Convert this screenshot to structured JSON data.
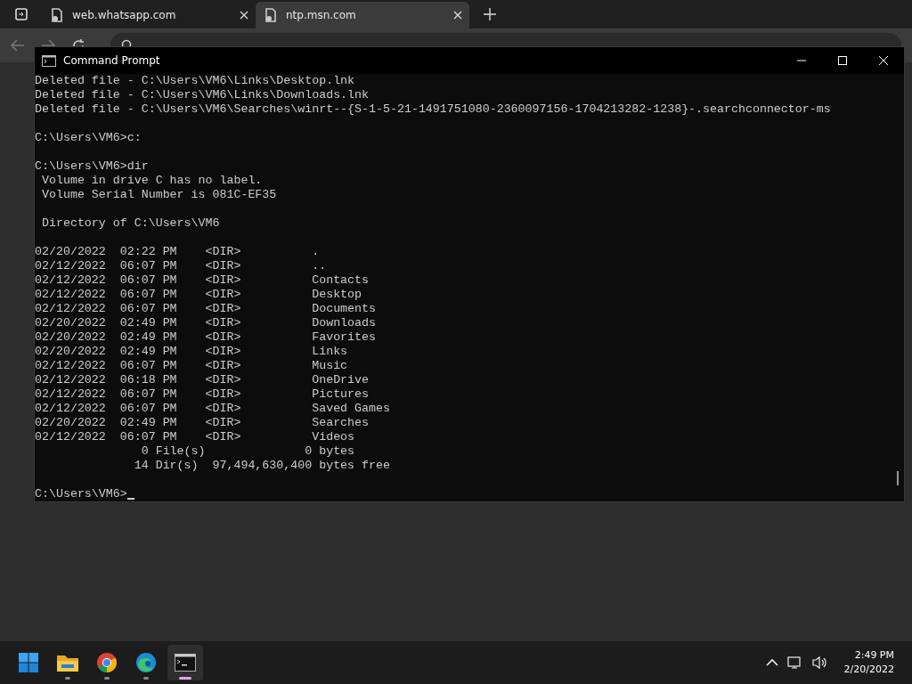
{
  "browser": {
    "tabs": [
      {
        "label": "web.whatsapp.com",
        "selected": false
      },
      {
        "label": "ntp.msn.com",
        "selected": true
      }
    ]
  },
  "console": {
    "title": "Command Prompt",
    "lines": [
      {
        "kind": "text",
        "text": "Deleted file - C:\\Users\\VM6\\Links\\Desktop.lnk"
      },
      {
        "kind": "text",
        "text": "Deleted file - C:\\Users\\VM6\\Links\\Downloads.lnk"
      },
      {
        "kind": "text",
        "text": "Deleted file - C:\\Users\\VM6\\Searches\\winrt--{S-1-5-21-1491751080-2360097156-1704213282-1238}-.searchconnector-ms"
      },
      {
        "kind": "blank"
      },
      {
        "kind": "text",
        "text": "C:\\Users\\VM6>c:"
      },
      {
        "kind": "blank"
      },
      {
        "kind": "text",
        "text": "C:\\Users\\VM6>dir"
      },
      {
        "kind": "text",
        "text": " Volume in drive C has no label."
      },
      {
        "kind": "text",
        "text": " Volume Serial Number is 081C-EF35"
      },
      {
        "kind": "blank"
      },
      {
        "kind": "text",
        "text": " Directory of C:\\Users\\VM6"
      },
      {
        "kind": "blank"
      },
      {
        "kind": "text",
        "text": "02/20/2022  02:22 PM    <DIR>          ."
      },
      {
        "kind": "text",
        "text": "02/12/2022  06:07 PM    <DIR>          .."
      },
      {
        "kind": "text",
        "text": "02/12/2022  06:07 PM    <DIR>          Contacts"
      },
      {
        "kind": "text",
        "text": "02/12/2022  06:07 PM    <DIR>          Desktop"
      },
      {
        "kind": "text",
        "text": "02/12/2022  06:07 PM    <DIR>          Documents"
      },
      {
        "kind": "text",
        "text": "02/20/2022  02:49 PM    <DIR>          Downloads"
      },
      {
        "kind": "text",
        "text": "02/20/2022  02:49 PM    <DIR>          Favorites"
      },
      {
        "kind": "text",
        "text": "02/20/2022  02:49 PM    <DIR>          Links"
      },
      {
        "kind": "text",
        "text": "02/12/2022  06:07 PM    <DIR>          Music"
      },
      {
        "kind": "text",
        "text": "02/12/2022  06:18 PM    <DIR>          OneDrive"
      },
      {
        "kind": "text",
        "text": "02/12/2022  06:07 PM    <DIR>          Pictures"
      },
      {
        "kind": "text",
        "text": "02/12/2022  06:07 PM    <DIR>          Saved Games"
      },
      {
        "kind": "text",
        "text": "02/20/2022  02:49 PM    <DIR>          Searches"
      },
      {
        "kind": "text",
        "text": "02/12/2022  06:07 PM    <DIR>          Videos"
      },
      {
        "kind": "text",
        "text": "               0 File(s)              0 bytes"
      },
      {
        "kind": "text",
        "text": "              14 Dir(s)  97,494,630,400 bytes free"
      },
      {
        "kind": "blank"
      },
      {
        "kind": "prompt",
        "text": "C:\\Users\\VM6>"
      }
    ]
  },
  "taskbar": {
    "apps": [
      {
        "kind": "start",
        "selected": false
      },
      {
        "kind": "explorer",
        "running": true,
        "selected": false
      },
      {
        "kind": "chrome",
        "running": true,
        "selected": false
      },
      {
        "kind": "edge",
        "running": true,
        "selected": false
      },
      {
        "kind": "terminal",
        "running": true,
        "selected": true
      }
    ],
    "time": "2:49 PM",
    "date": "2/20/2022"
  }
}
